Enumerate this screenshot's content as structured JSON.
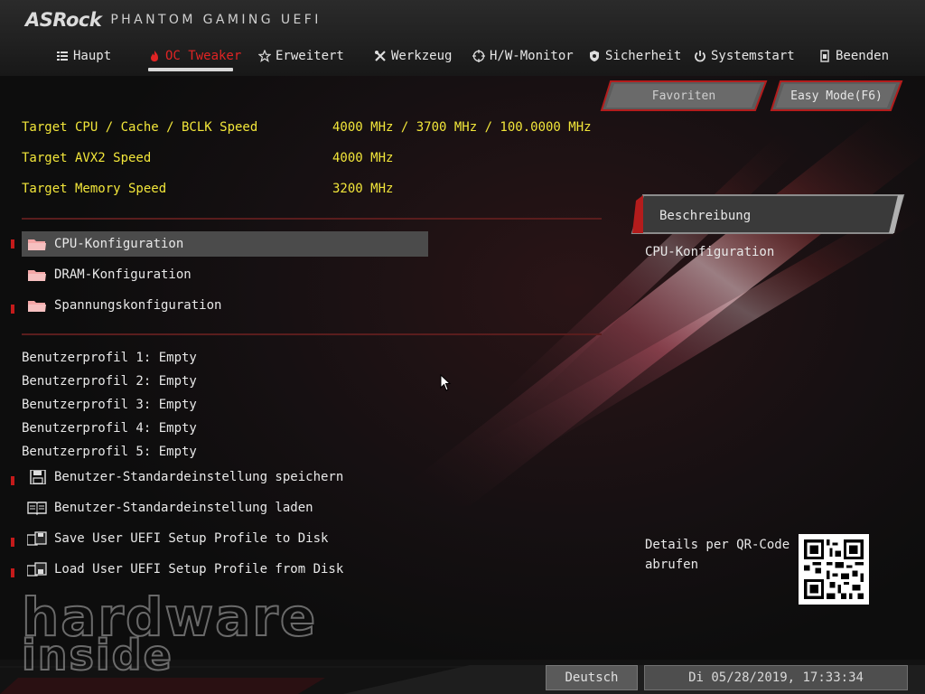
{
  "brand": {
    "logo": "ASRock",
    "subtitle": "PHANTOM GAMING UEFI"
  },
  "tabs": [
    {
      "label": "Haupt",
      "icon": "list-icon",
      "active": false
    },
    {
      "label": "OC Tweaker",
      "icon": "flame-icon",
      "active": true
    },
    {
      "label": "Erweitert",
      "icon": "star-icon",
      "active": false
    },
    {
      "label": "Werkzeug",
      "icon": "tools-icon",
      "active": false
    },
    {
      "label": "H/W-Monitor",
      "icon": "crosshair-icon",
      "active": false
    },
    {
      "label": "Sicherheit",
      "icon": "shield-icon",
      "active": false
    },
    {
      "label": "Systemstart",
      "icon": "power-icon",
      "active": false
    },
    {
      "label": "Beenden",
      "icon": "exit-icon",
      "active": false
    }
  ],
  "buttons": {
    "favorites": "Favoriten",
    "easy_mode": "Easy Mode(F6)"
  },
  "targets": [
    {
      "label": "Target CPU / Cache / BCLK Speed",
      "value": "4000 MHz / 3700 MHz / 100.0000 MHz"
    },
    {
      "label": "Target AVX2 Speed",
      "value": "4000 MHz"
    },
    {
      "label": "Target Memory Speed",
      "value": "3200 MHz"
    }
  ],
  "menu": [
    {
      "label": "CPU-Konfiguration",
      "icon": "folder-icon",
      "selected": true
    },
    {
      "label": "DRAM-Konfiguration",
      "icon": "folder-icon",
      "selected": false
    },
    {
      "label": "Spannungskonfiguration",
      "icon": "folder-icon",
      "selected": false
    }
  ],
  "profiles": [
    "Benutzerprofil 1: Empty",
    "Benutzerprofil 2: Empty",
    "Benutzerprofil 3: Empty",
    "Benutzerprofil 4: Empty",
    "Benutzerprofil 5: Empty"
  ],
  "actions": [
    {
      "label": "Benutzer-Standardeinstellung speichern",
      "icon": "floppy-icon"
    },
    {
      "label": "Benutzer-Standardeinstellung laden",
      "icon": "book-icon"
    },
    {
      "label": "Save User UEFI Setup Profile to Disk",
      "icon": "disk-save-icon"
    },
    {
      "label": "Load User UEFI Setup Profile from Disk",
      "icon": "disk-load-icon"
    }
  ],
  "description": {
    "title": "Beschreibung",
    "text": "CPU-Konfiguration"
  },
  "qr": {
    "text": "Details per QR-Code abrufen"
  },
  "watermark": {
    "line1": "hardware",
    "line2": "inside"
  },
  "footer": {
    "language": "Deutsch",
    "datetime": "Di 05/28/2019, 17:33:34"
  },
  "colors": {
    "accent": "#e02424",
    "target_text": "#f2e63a",
    "selected_bg": "#4b4b4b"
  }
}
